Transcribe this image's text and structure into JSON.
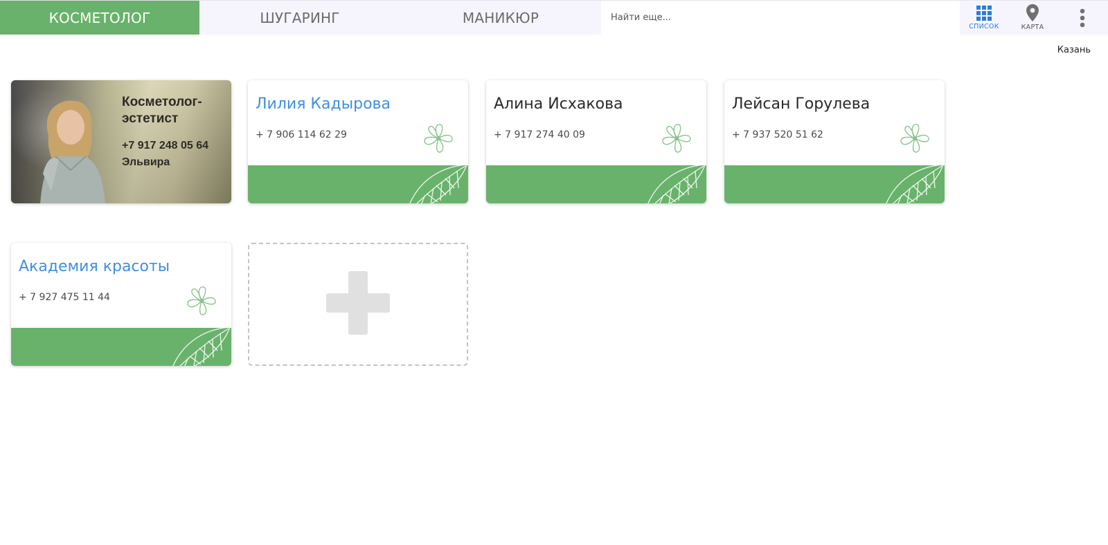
{
  "nav": {
    "tabs": [
      {
        "label": "КОСМЕТОЛОГ",
        "active": true
      },
      {
        "label": "ШУГАРИНГ",
        "active": false
      },
      {
        "label": "МАНИКЮР",
        "active": false
      }
    ],
    "search_placeholder": "Найти еще...",
    "list_label": "СПИСОК",
    "map_label": "КАРТА"
  },
  "city": "Казань",
  "photo_card": {
    "title": "Косметолог-эстетист",
    "phone": "+7 917 248 05 64",
    "name": "Эльвира"
  },
  "cards": [
    {
      "name": "Лилия Кадырова",
      "phone": "+ 7 906 114 62 29"
    },
    {
      "name": "Алина Исхакова",
      "phone": "+ 7 917 274 40 09"
    },
    {
      "name": "Лейсан Горулева",
      "phone": "+ 7 937 520 51 62"
    },
    {
      "name": "Академия красоты",
      "phone": "+ 7 927 475 11 44"
    }
  ],
  "colors": {
    "accent_green": "#69b26b",
    "link_blue": "#3f8fe0",
    "active_icon_blue": "#2c7fd6",
    "nav_bg": "#f6f5fe"
  },
  "icons": {
    "list": "grid-icon",
    "map": "map-pin-icon",
    "more": "more-vertical-icon",
    "card_decoration": "flower-icon",
    "band_decoration": "leaf-icon",
    "add": "plus-icon"
  }
}
